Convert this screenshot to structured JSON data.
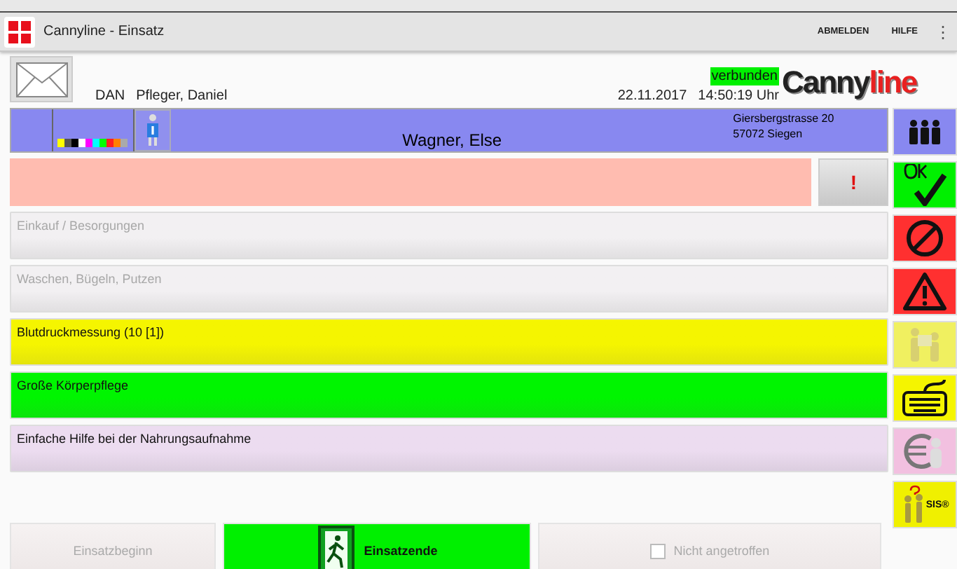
{
  "window": {
    "title": "Cannyline - Einsatz"
  },
  "app_bar": {
    "actions": [
      "ABMELDEN",
      "HILFE"
    ],
    "overflow": "⋮"
  },
  "header": {
    "user_code": "DAN",
    "user_name": "Pfleger, Daniel",
    "date": "22.11.2017",
    "time": "14:50:19 Uhr",
    "connection": "verbunden",
    "logo": {
      "first": "Canny",
      "second": "line"
    }
  },
  "patient": {
    "name": "Wagner, Else",
    "address": [
      "Giersbergstrasse 20",
      "57072 Siegen"
    ]
  },
  "alert": {
    "button": "!"
  },
  "tasks": [
    {
      "label": "Einkauf / Besorgungen",
      "disabled": true,
      "color": "#f2f0f2"
    },
    {
      "label": "Waschen, Bügeln, Putzen",
      "disabled": true,
      "color": "#f2f0f2"
    },
    {
      "label": "Blutdruckmessung (10 [1])",
      "disabled": false,
      "color": "#f5f500"
    },
    {
      "label": "Große Körperpflege",
      "disabled": false,
      "color": "#00f500"
    },
    {
      "label": "Einfache Hilfe bei der Nahrungsaufnahme",
      "disabled": false,
      "color": "#ecdcf0"
    }
  ],
  "side_buttons": [
    {
      "kind": "people",
      "color": "#8888f0"
    },
    {
      "kind": "ok",
      "color": "#00f000"
    },
    {
      "kind": "prohibited",
      "color": "#ff3030"
    },
    {
      "kind": "warning",
      "color": "#ff3030"
    },
    {
      "kind": "figures",
      "color": "#f0f060"
    },
    {
      "kind": "keyboard",
      "color": "#f5f500"
    },
    {
      "kind": "person",
      "color": "#f2c0e0"
    },
    {
      "kind": "sis",
      "color": "#f0f000",
      "label": "SIS®"
    }
  ],
  "bottom": {
    "start": {
      "label": "Einsatzbeginn",
      "disabled": true
    },
    "end": {
      "label": "Einsatzende",
      "disabled": false
    },
    "absent": {
      "label": "Nicht angetroffen",
      "checked": false,
      "disabled": true
    }
  }
}
